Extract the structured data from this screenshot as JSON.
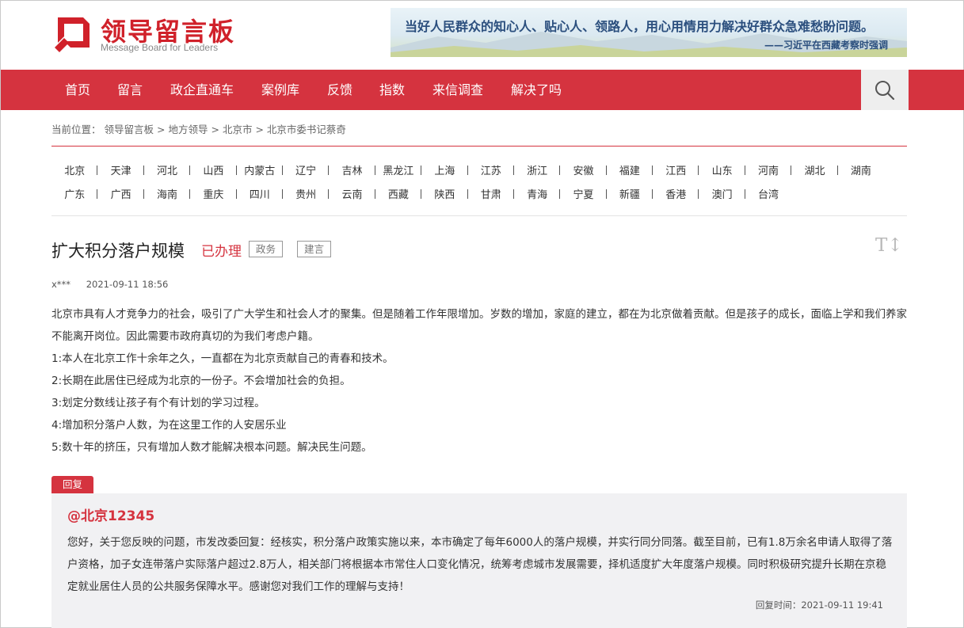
{
  "logo": {
    "cn": "领导留言板",
    "en": "Message Board for Leaders",
    "brand_color": "#d0212a"
  },
  "banner": {
    "quote": "当好人民群众的知心人、贴心人、领路人，用心用情用力解决好群众急难愁盼问题。",
    "source": "——习近平在西藏考察时强调"
  },
  "nav": {
    "items": [
      "首页",
      "留言",
      "政企直通车",
      "案例库",
      "反馈",
      "指数",
      "来信调查",
      "解决了吗"
    ],
    "search_icon": "search-icon",
    "bg_color": "#d5333f"
  },
  "breadcrumb": {
    "prefix": "当前位置：",
    "items": [
      "领导留言板",
      "地方领导",
      "北京市",
      "北京市委书记蔡奇"
    ],
    "sep": ">"
  },
  "regions": {
    "row1": [
      "北京",
      "天津",
      "河北",
      "山西",
      "内蒙古",
      "辽宁",
      "吉林",
      "黑龙江",
      "上海",
      "江苏",
      "浙江",
      "安徽",
      "福建",
      "江西",
      "山东",
      "河南",
      "湖北",
      "湖南"
    ],
    "row2": [
      "广东",
      "广西",
      "海南",
      "重庆",
      "四川",
      "贵州",
      "云南",
      "西藏",
      "陕西",
      "甘肃",
      "青海",
      "宁夏",
      "新疆",
      "香港",
      "澳门",
      "台湾"
    ]
  },
  "message": {
    "title": "扩大积分落户规模",
    "status": "已办理",
    "tags": [
      "政务",
      "建言"
    ],
    "font_toggle": "T↕",
    "author": "x***",
    "date": "2021-09-11 18:56",
    "paragraphs": [
      "北京市具有人才竞争力的社会，吸引了广大学生和社会人才的聚集。但是随着工作年限增加。岁数的增加，家庭的建立，都在为北京做着贡献。但是孩子的成长，面临上学和我们养家不能离开岗位。因此需要市政府真切的为我们考虑户籍。",
      "1:本人在北京工作十余年之久，一直都在为北京贡献自己的青春和技术。",
      "2:长期在此居住已经成为北京的一份子。不会增加社会的负担。",
      "3:划定分数线让孩子有个有计划的学习过程。",
      "4:增加积分落户人数，为在这里工作的人安居乐业",
      "5:数十年的挤压，只有增加人数才能解决根本问题。解决民生问题。"
    ]
  },
  "reply": {
    "label": "回复",
    "from": "@北京12345",
    "text": "您好，关于您反映的问题，市发改委回复：经核实，积分落户政策实施以来，本市确定了每年6000人的落户规模，并实行同分同落。截至目前，已有1.8万余名申请人取得了落户资格，加子女连带落户实际落户超过2.8万人，相关部门将根据本市常住人口变化情况，统筹考虑城市发展需要，择机适度扩大年度落户规模。同时积极研究提升长期在京稳定就业居住人员的公共服务保障水平。感谢您对我们工作的理解与支持！",
    "time_label": "回复时间：",
    "time": "2021-09-11 19:41"
  }
}
